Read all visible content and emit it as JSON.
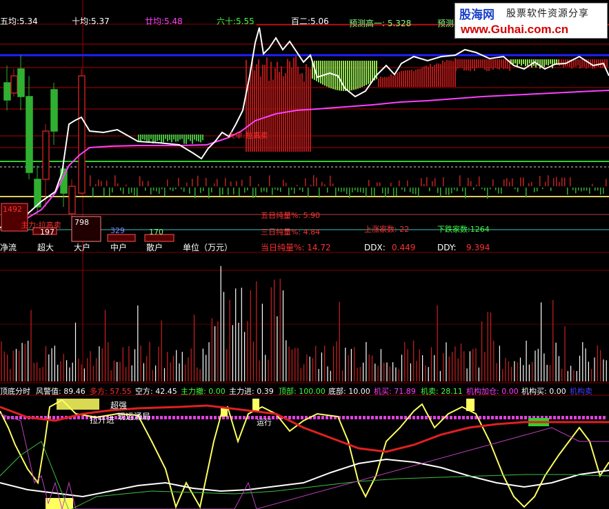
{
  "ma_labels": [
    {
      "text": "五均:5.34",
      "color": "#ffffff"
    },
    {
      "text": "十均:5.37",
      "color": "#ffffff"
    },
    {
      "text": "廿均:5.48",
      "color": "#ff40ff"
    },
    {
      "text": "六十:5.55",
      "color": "#40ff40"
    },
    {
      "text": "百二:5.06",
      "color": "#ffffff"
    },
    {
      "text": "预测高一: 5.328",
      "color": "#80ff80"
    },
    {
      "text": "预测",
      "color": "#80ff80"
    }
  ],
  "money_flow": {
    "values": [
      {
        "text": "1492",
        "color": "#ff3030"
      },
      {
        "text": "197",
        "color": "#ffffff"
      },
      {
        "text": "798",
        "color": "#ffffff"
      },
      {
        "text": "329",
        "color": "#8080ff"
      },
      {
        "text": "170",
        "color": "#80ff80"
      }
    ],
    "labels": [
      "净流",
      "超大",
      "大户",
      "中户",
      "散户",
      "单位（万元）"
    ],
    "annotations": [
      "主力:拉高卖",
      "大单:拉高卖"
    ]
  },
  "stats": [
    {
      "text": "五日纯量%: 5.90",
      "color": "#ff3030"
    },
    {
      "text": "三日纯量%: 4.84",
      "color": "#ff3030"
    },
    {
      "text": "当日纯量%: 14.72",
      "color": "#ff3030"
    },
    {
      "text": "上涨家数: 22",
      "color": "#ff3030"
    },
    {
      "text": "下跌家数:1264",
      "color": "#40ff40"
    }
  ],
  "ddx": {
    "label": "DDX:",
    "value": "0.449",
    "label_color": "#ffffff",
    "value_color": "#ff3030"
  },
  "ddy": {
    "label": "DDY:",
    "value": "9.394",
    "label_color": "#ffffff",
    "value_color": "#ff3030"
  },
  "indicator_bar": [
    {
      "text": "顶底分时",
      "color": "#ffffff"
    },
    {
      "text": "风警值: 89.46",
      "color": "#ffffff"
    },
    {
      "text": "多方: 57.55",
      "color": "#ff3030"
    },
    {
      "text": "空方: 42.45",
      "color": "#ffffff"
    },
    {
      "text": "主力撤: 0.00",
      "color": "#40ff40"
    },
    {
      "text": "主力进: 0.39",
      "color": "#ffffff"
    },
    {
      "text": "顶部: 100.00",
      "color": "#40ff40"
    },
    {
      "text": "底部: 10.00",
      "color": "#ffffff"
    },
    {
      "text": "机买: 71.89",
      "color": "#ff40ff"
    },
    {
      "text": "机卖: 28.11",
      "color": "#40ff40"
    },
    {
      "text": "机构加仓: 0.00",
      "color": "#ff40ff"
    },
    {
      "text": "机构买: 0.00",
      "color": "#ffffff"
    },
    {
      "text": "机构卖",
      "color": "#4040ff"
    }
  ],
  "bottom_annotations": [
    {
      "text": "超强",
      "color": "#ffffff"
    },
    {
      "text": "现运涌局",
      "color": "#ffffff"
    },
    {
      "text": "拉升进",
      "color": "#ffffff"
    },
    {
      "text": "运行",
      "color": "#ffffff"
    }
  ],
  "watermark": {
    "logo": "股海网",
    "slogan": "股票软件资源分享",
    "url": "www.Guhai.com.cn"
  },
  "colors": {
    "up": "#ff3030",
    "down": "#40ff40",
    "price_line": "#ffffff",
    "avg_line": "#ff40ff",
    "predict_line": "#2020ff",
    "grid": "#800000",
    "k_line": "#ffff60",
    "d_line": "#ff2020"
  }
}
